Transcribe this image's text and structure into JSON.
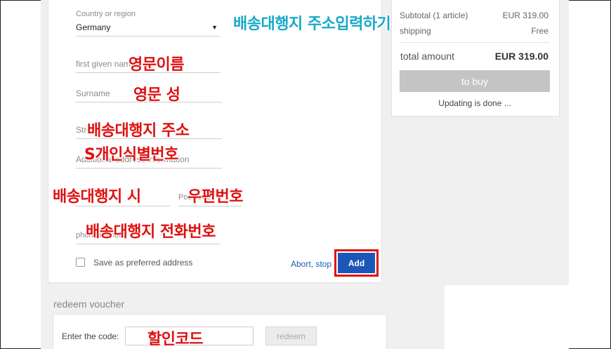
{
  "annotations": {
    "title": "배송대행지 주소입력하기",
    "first_name": "영문이름",
    "surname": "영문 성",
    "street": "배송대행지 주소",
    "additional": "S개인식별번호",
    "city": "배송대행지 시",
    "postcode": "우편번호",
    "phone": "배송대행지 전화번호",
    "code": "할인코드"
  },
  "form": {
    "country_label": "Country or region",
    "country_value": "Germany",
    "first_name_label": "first given name",
    "surname_label": "Surname",
    "street_label": "Street",
    "additional_label": "Additional address information",
    "postcode_label": "Postcode",
    "phone_label": "phone number",
    "save_preferred_label": "Save as preferred address",
    "abort_label": "Abort, stop",
    "add_label": "Add"
  },
  "summary": {
    "subtotal_label": "Subtotal (1 article)",
    "subtotal_value": "EUR 319.00",
    "shipping_label": "shipping",
    "shipping_value": "Free",
    "total_label": "total amount",
    "total_value": "EUR 319.00",
    "buy_label": "to buy",
    "status": "Updating is done ..."
  },
  "voucher": {
    "title": "redeem voucher",
    "code_label": "Enter the code:",
    "redeem_label": "redeem"
  },
  "colors": {
    "annotation_red": "#e01010",
    "annotation_cyan": "#18a9c8",
    "primary_button": "#1b56b8",
    "link": "#1a5fb4"
  }
}
